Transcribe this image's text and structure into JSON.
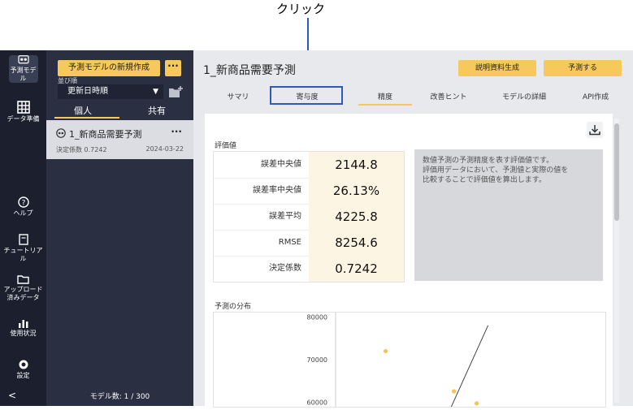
{
  "annotation": {
    "label": "クリック",
    "color": "#2f59b6"
  },
  "rail": {
    "items": [
      {
        "label": "予測モデル",
        "icon": "model-icon"
      },
      {
        "label": "データ準備",
        "icon": "table-icon"
      },
      {
        "label": "ヘルプ",
        "icon": "help-icon"
      },
      {
        "label_lines": [
          "チュートリア",
          "ル"
        ],
        "icon": "book-icon"
      },
      {
        "label_lines": [
          "アップロード",
          "済みデータ"
        ],
        "icon": "folder-icon"
      },
      {
        "label": "使用状況",
        "icon": "bar-chart-icon"
      },
      {
        "label": "設定",
        "icon": "gear-icon"
      }
    ],
    "collapse_glyph": "<"
  },
  "list_panel": {
    "new_model_button": "予測モデルの新規作成",
    "more_glyph": "···",
    "sort_label": "並び順",
    "sort_value": "更新日時順",
    "tabs": [
      "個人",
      "共有"
    ],
    "model": {
      "name": "1_新商品需要予測",
      "score_text": "決定係数 0.7242",
      "date": "2024-03-22"
    },
    "model_count": "モデル数: 1 / 300"
  },
  "main": {
    "title": "1_新商品需要予測",
    "buttons": {
      "explain": "説明資料生成",
      "predict": "予測する"
    },
    "tabs": [
      "サマリ",
      "寄与度",
      "精度",
      "改善ヒント",
      "モデルの詳細",
      "API作成"
    ],
    "active_tab_index": 2,
    "section_metrics_label": "評価値",
    "metrics": [
      {
        "name": "誤差中央値",
        "value": "2144.8"
      },
      {
        "name": "誤差率中央値",
        "value": "26.13%"
      },
      {
        "name": "誤差平均",
        "value": "4225.8"
      },
      {
        "name": "RMSE",
        "value": "8254.6"
      },
      {
        "name": "決定係数",
        "value": "0.7242"
      }
    ],
    "description_lines": [
      "数値予測の予測精度を表す評価値です。",
      "評価用データにおいて、予測値と実際の値を",
      "比較することで評価値を算出します。"
    ],
    "section_distribution_label": "予測の分布"
  },
  "chart_data": {
    "type": "scatter",
    "title": "予測の分布",
    "yticks": [
      "80000",
      "70000",
      "60000"
    ],
    "y_values": [
      80000,
      70000,
      60000
    ],
    "ylim": [
      59000,
      81000
    ],
    "xlim": [
      0,
      100
    ],
    "points": [
      {
        "x": 22,
        "y": 72000
      },
      {
        "x": 52,
        "y": 62600
      },
      {
        "x": 62,
        "y": 59800
      }
    ],
    "reference_line": [
      {
        "x": 50,
        "y": 58000
      },
      {
        "x": 67,
        "y": 78000
      }
    ],
    "point_color": "#f5c15a"
  }
}
